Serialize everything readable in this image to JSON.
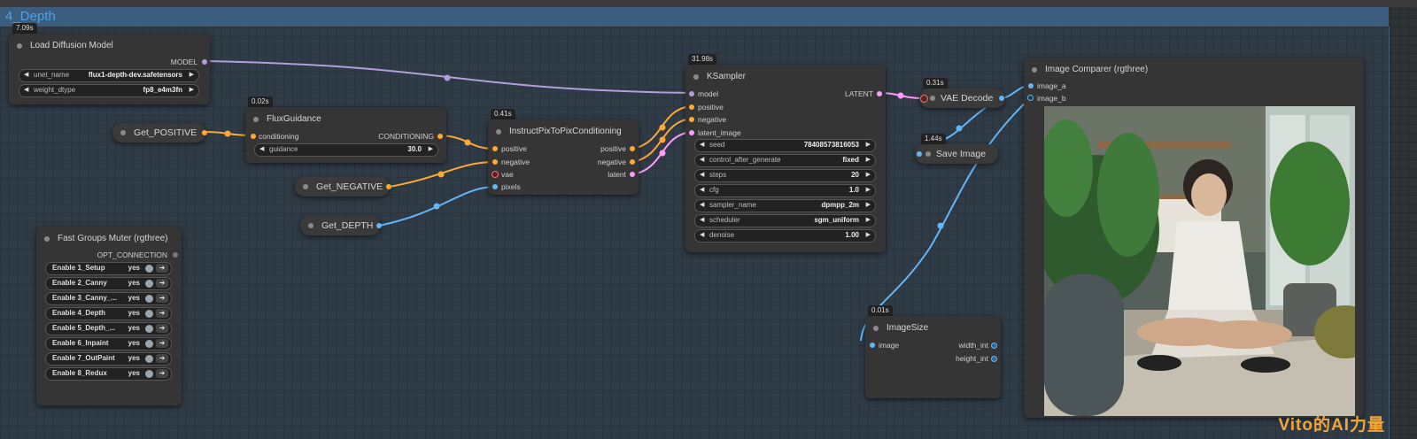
{
  "group": {
    "title": "4_Depth"
  },
  "nodes": {
    "load_diffusion": {
      "timing": "7.09s",
      "title": "Load Diffusion Model",
      "output": "MODEL",
      "widgets": [
        {
          "label": "unet_name",
          "value": "flux1-depth-dev.safetensors"
        },
        {
          "label": "weight_dtype",
          "value": "fp8_e4m3fn"
        }
      ]
    },
    "get_positive": {
      "title": "Get_POSITIVE"
    },
    "get_negative": {
      "title": "Get_NEGATIVE"
    },
    "get_depth": {
      "title": "Get_DEPTH"
    },
    "flux_guidance": {
      "timing": "0.02s",
      "title": "FluxGuidance",
      "input": "conditioning",
      "output": "CONDITIONING",
      "widget": {
        "label": "guidance",
        "value": "30.0"
      }
    },
    "ip2p": {
      "timing": "0.41s",
      "title": "InstructPixToPixConditioning",
      "inputs": [
        "positive",
        "negative",
        "vae",
        "pixels"
      ],
      "outputs": [
        "positive",
        "negative",
        "latent"
      ]
    },
    "ksampler": {
      "timing": "31.98s",
      "title": "KSampler",
      "inputs": [
        "model",
        "positive",
        "negative",
        "latent_image"
      ],
      "output": "LATENT",
      "widgets": [
        {
          "label": "seed",
          "value": "78408573816053"
        },
        {
          "label": "control_after_generate",
          "value": "fixed"
        },
        {
          "label": "steps",
          "value": "20"
        },
        {
          "label": "cfg",
          "value": "1.0"
        },
        {
          "label": "sampler_name",
          "value": "dpmpp_2m"
        },
        {
          "label": "scheduler",
          "value": "sgm_uniform"
        },
        {
          "label": "denoise",
          "value": "1.00"
        }
      ]
    },
    "vae_decode": {
      "timing": "0.31s",
      "title": "VAE Decode"
    },
    "save_image": {
      "timing": "1.44s",
      "title": "Save Image"
    },
    "image_size": {
      "timing": "0.01s",
      "title": "ImageSize",
      "input": "image",
      "outputs": [
        "width_int",
        "height_int"
      ]
    },
    "image_comparer": {
      "title": "Image Comparer (rgthree)",
      "inputs": [
        "image_a",
        "image_b"
      ]
    },
    "groups_muter": {
      "title": "Fast Groups Muter (rgthree)",
      "output": "OPT_CONNECTION",
      "toggles": [
        {
          "label": "Enable 1_Setup",
          "value": "yes"
        },
        {
          "label": "Enable 2_Canny",
          "value": "yes"
        },
        {
          "label": "Enable 3_Canny_...",
          "value": "yes"
        },
        {
          "label": "Enable 4_Depth",
          "value": "yes"
        },
        {
          "label": "Enable 5_Depth_...",
          "value": "yes"
        },
        {
          "label": "Enable 6_Inpaint",
          "value": "yes"
        },
        {
          "label": "Enable 7_OutPaint",
          "value": "yes"
        },
        {
          "label": "Enable 8_Redux",
          "value": "yes"
        }
      ]
    }
  },
  "watermark": "Vito的AI力量",
  "colors": {
    "model_wire": "#b39ddb",
    "conditioning_wire": "#ffa931",
    "latent_wire": "#ff9cf9",
    "image_wire": "#64b5f6",
    "vae_pin": "#ff6e6e",
    "group_header": "#3c5e7e"
  }
}
